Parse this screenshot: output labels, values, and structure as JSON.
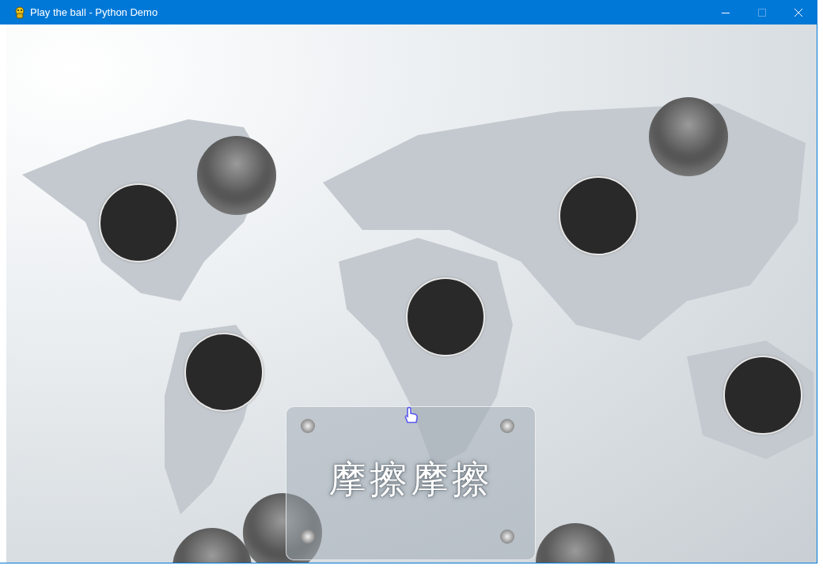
{
  "window": {
    "title": "Play the ball - Python Demo"
  },
  "balls": [
    {
      "kind": "hole"
    },
    {
      "kind": "glossy"
    },
    {
      "kind": "glossy"
    },
    {
      "kind": "hole"
    },
    {
      "kind": "hole"
    },
    {
      "kind": "hole"
    },
    {
      "kind": "hole"
    },
    {
      "kind": "glossy"
    },
    {
      "kind": "glossy"
    },
    {
      "kind": "glossy"
    }
  ],
  "panel": {
    "label": "摩擦摩擦"
  }
}
